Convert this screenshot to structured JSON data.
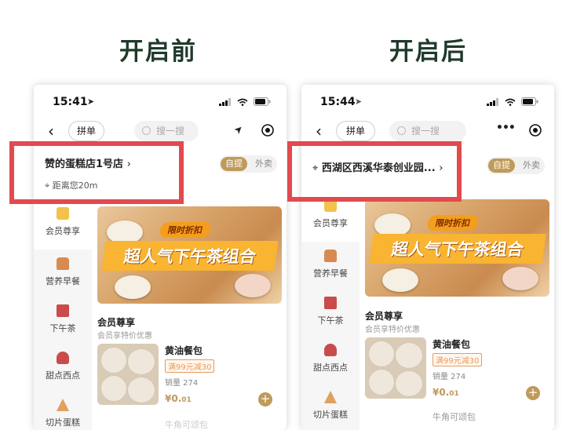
{
  "headings": {
    "before": "开启前",
    "after": "开启后"
  },
  "before": {
    "time": "15:41",
    "group_btn": "拼单",
    "search_placeholder": "搜一搜",
    "store_name": "赞的蛋糕店1号店",
    "distance": "距离您20m",
    "toggle_on": "自提",
    "toggle_off": "外卖"
  },
  "after": {
    "time": "15:44",
    "group_btn": "拼单",
    "search_placeholder": "搜一搜",
    "address": "西湖区西溪华泰创业园...",
    "toggle_on": "自提",
    "toggle_off": "外卖"
  },
  "sidebar": [
    "会员尊享",
    "营养早餐",
    "下午茶",
    "甜点西点",
    "切片蛋糕"
  ],
  "banner": {
    "tag": "限时折扣",
    "title": "超人气下午茶组合"
  },
  "section": {
    "title": "会员尊享",
    "subtitle": "会员享特价优惠"
  },
  "product": {
    "name": "黄油餐包",
    "promo": "满99元减30",
    "sales": "销量 274",
    "price_main": "¥0.",
    "price_dec": "01"
  },
  "next_product": "牛角可颂包",
  "colors": {
    "accent": "#bf9a5a",
    "highlight": "#e24a4e",
    "heading": "#1f3a2a"
  }
}
